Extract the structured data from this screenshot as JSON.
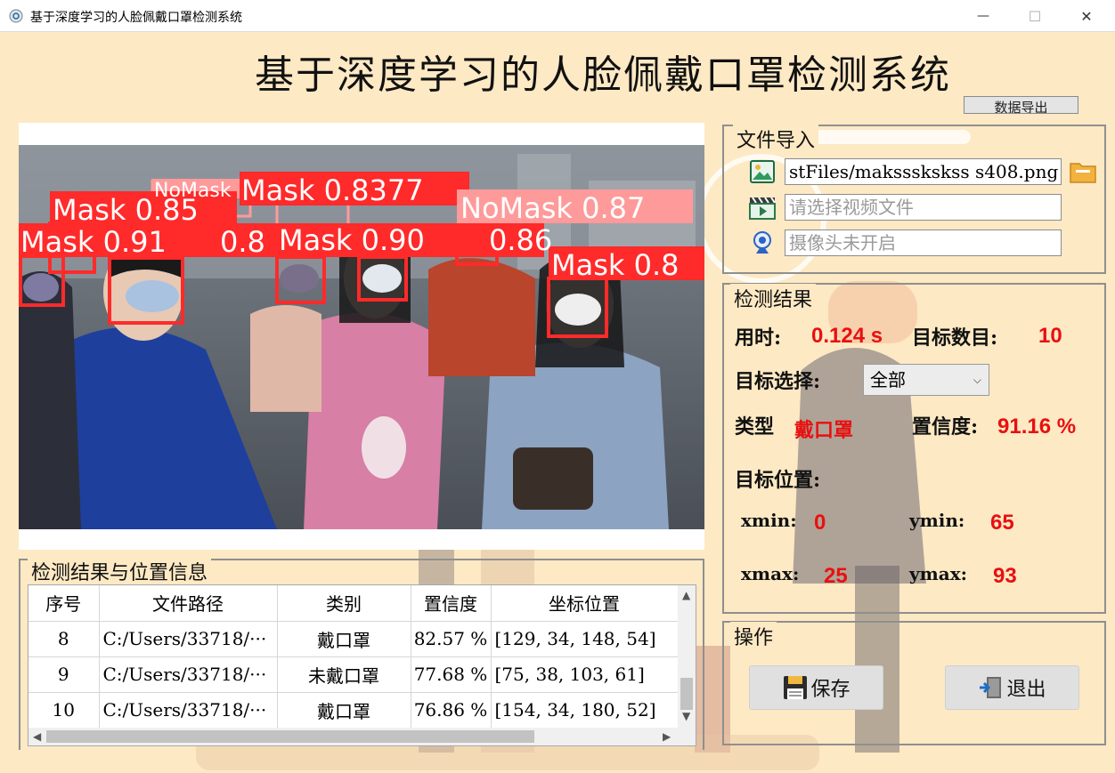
{
  "window": {
    "title": "基于深度学习的人脸佩戴口罩检测系统",
    "min_glyph": "—",
    "max_glyph": "☐",
    "close_glyph": "✕"
  },
  "header": {
    "main_title": "基于深度学习的人脸佩戴口罩检测系统",
    "export_label": "数据导出"
  },
  "detections": [
    {
      "label": "Mask 0.85"
    },
    {
      "label": "NoMask"
    },
    {
      "label": "Mask 0.8377"
    },
    {
      "label": "NoMask 0.87"
    },
    {
      "label": "Mask 0.91"
    },
    {
      "label": "0.8"
    },
    {
      "label": "Mask 0.90"
    },
    {
      "label": "0.86"
    },
    {
      "label": "Mask 0.8"
    }
  ],
  "file_import": {
    "title": "文件导入",
    "image_path": "stFiles/makssskskss s408.png",
    "video_placeholder": "请选择视频文件",
    "camera_placeholder": "摄像头未开启"
  },
  "result": {
    "title": "检测结果",
    "time_label": "用时:",
    "time_value": "0.124 s",
    "count_label": "目标数目:",
    "count_value": "10",
    "select_label": "目标选择:",
    "select_value": "全部",
    "type_label": "类型",
    "type_value": "戴口罩",
    "conf_label": "置信度:",
    "conf_value": "91.16 %",
    "pos_label": "目标位置:",
    "xmin_label": "xmin:",
    "xmin_value": "0",
    "ymin_label": "ymin:",
    "ymin_value": "65",
    "xmax_label": "xmax:",
    "xmax_value": "25",
    "ymax_label": "ymax:",
    "ymax_value": "93"
  },
  "operations": {
    "title": "操作",
    "save_label": "保存",
    "exit_label": "退出"
  },
  "table": {
    "title": "检测结果与位置信息",
    "headers": [
      "序号",
      "文件路径",
      "类别",
      "置信度",
      "坐标位置"
    ],
    "rows": [
      [
        "8",
        "C:/Users/33718/···",
        "戴口罩",
        "82.57 %",
        "[129, 34, 148, 54]"
      ],
      [
        "9",
        "C:/Users/33718/···",
        "未戴口罩",
        "77.68 %",
        "[75, 38, 103, 61]"
      ],
      [
        "10",
        "C:/Users/33718/···",
        "戴口罩",
        "76.86 %",
        "[154, 34, 180, 52]"
      ]
    ]
  }
}
